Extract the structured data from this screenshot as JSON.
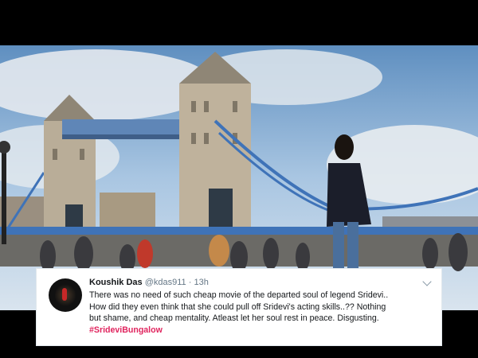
{
  "tweet": {
    "name": "Koushik Das",
    "handle": "@kdas911",
    "separator": "·",
    "time": "13h",
    "lines": [
      "There was no need of such cheap movie of the departed soul of legend Sridevi..",
      "How did they even think that she could pull off Sridevi's acting skills..?? Nothing",
      "but shame, and cheap mentality. Atleast let her soul rest in peace. Disgusting."
    ],
    "hashtag": "#SrideviBungalow",
    "hashtag_color": "#e0245e"
  },
  "icons": [
    "avatar-image",
    "chevron-down-icon"
  ],
  "colors": {
    "sky": "#a9c6e2",
    "bridge_stone": "#b9ad98",
    "bridge_blue": "#3f73b8",
    "letterbox": "#000000"
  }
}
